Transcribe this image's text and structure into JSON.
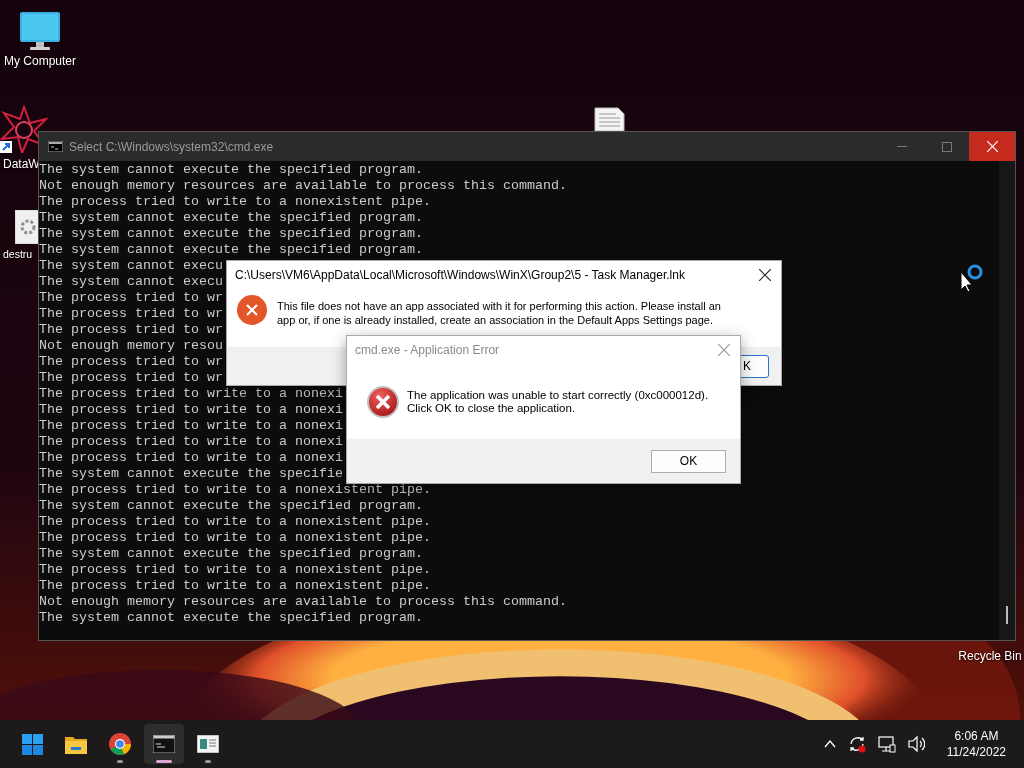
{
  "desktop_icons": [
    {
      "kind": "computer",
      "label": "My Computer"
    },
    {
      "kind": "shortcut",
      "label": "DataW"
    },
    {
      "kind": "file",
      "label": "destru"
    },
    {
      "kind": "document"
    },
    {
      "kind": "recycle",
      "label": "Recycle Bin"
    }
  ],
  "console": {
    "title": "Select C:\\Windows\\system32\\cmd.exe",
    "lines": [
      "The system cannot execute the specified program.",
      "Not enough memory resources are available to process this command.",
      "The process tried to write to a nonexistent pipe.",
      "The system cannot execute the specified program.",
      "The system cannot execute the specified program.",
      "The system cannot execute the specified program.",
      "The system cannot execu",
      "The system cannot execu",
      "The process tried to wr",
      "The process tried to wr",
      "The process tried to wr",
      "Not enough memory resou",
      "The process tried to wr",
      "The process tried to wr",
      "The process tried to write to a nonexi",
      "The process tried to write to a nonexi",
      "The process tried to write to a nonexi",
      "The process tried to write to a nonexi",
      "The process tried to write to a nonexi",
      "The system cannot execute the specifie",
      "The process tried to write to a nonexistent pipe.",
      "The system cannot execute the specified program.",
      "The process tried to write to a nonexistent pipe.",
      "The process tried to write to a nonexistent pipe.",
      "The system cannot execute the specified program.",
      "The process tried to write to a nonexistent pipe.",
      "The process tried to write to a nonexistent pipe.",
      "Not enough memory resources are available to process this command.",
      "The system cannot execute the specified program."
    ]
  },
  "dialogs": [
    {
      "kind": "file-association",
      "active": true,
      "title": "C:\\Users\\VM6\\AppData\\Local\\Microsoft\\Windows\\WinX\\Group2\\5 - Task Manager.lnk",
      "message_lines": [
        "This file does not have an app associated with it for performing this action. Please install an",
        "app or, if one is already installed, create an association in the Default Apps Settings page."
      ],
      "button": "K"
    },
    {
      "kind": "app-error",
      "active": false,
      "title": "cmd.exe - Application Error",
      "message_lines": [
        "The application was unable to start correctly (0xc000012d).",
        "Click OK to close the application."
      ],
      "button": "OK"
    }
  ],
  "taskbar": {
    "apps": [
      {
        "kind": "start",
        "running": false,
        "selected": false
      },
      {
        "kind": "folder",
        "running": false,
        "selected": false
      },
      {
        "kind": "browser",
        "running": true,
        "selected": false
      },
      {
        "kind": "terminal",
        "running": true,
        "selected": true
      },
      {
        "kind": "window",
        "running": true,
        "selected": false
      }
    ],
    "tray": [
      {
        "kind": "chevron"
      },
      {
        "kind": "sync"
      },
      {
        "kind": "network"
      },
      {
        "kind": "volume"
      }
    ],
    "time": "6:06 AM",
    "date": "11/24/2022"
  }
}
